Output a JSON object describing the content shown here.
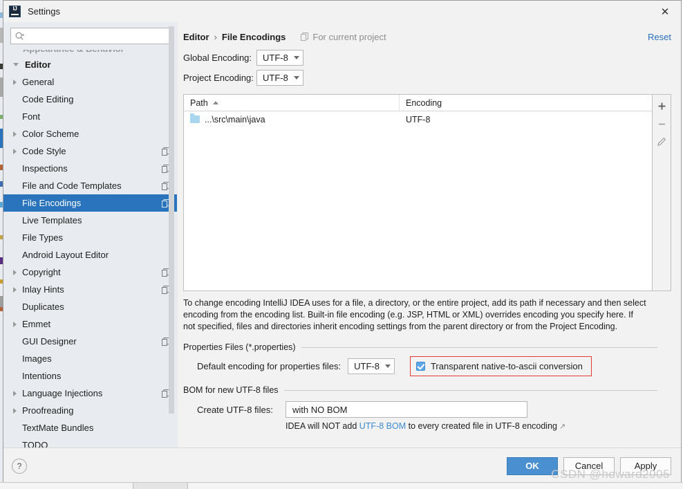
{
  "window": {
    "title": "Settings",
    "logo_icon": "intellij-idea-logo",
    "close_icon": "✕"
  },
  "sidebar": {
    "search": {
      "placeholder": "",
      "value": "",
      "icon": "search-icon"
    },
    "items": [
      {
        "label": "Editor",
        "level": 0,
        "arrow": "down",
        "badge": false,
        "selected": false
      },
      {
        "label": "General",
        "level": 1,
        "arrow": "right",
        "badge": false,
        "selected": false
      },
      {
        "label": "Code Editing",
        "level": 1,
        "arrow": "none",
        "badge": false,
        "selected": false
      },
      {
        "label": "Font",
        "level": 1,
        "arrow": "none",
        "badge": false,
        "selected": false
      },
      {
        "label": "Color Scheme",
        "level": 1,
        "arrow": "right",
        "badge": false,
        "selected": false
      },
      {
        "label": "Code Style",
        "level": 1,
        "arrow": "right",
        "badge": true,
        "selected": false
      },
      {
        "label": "Inspections",
        "level": 1,
        "arrow": "none",
        "badge": true,
        "selected": false
      },
      {
        "label": "File and Code Templates",
        "level": 1,
        "arrow": "none",
        "badge": true,
        "selected": false
      },
      {
        "label": "File Encodings",
        "level": 1,
        "arrow": "none",
        "badge": true,
        "selected": true
      },
      {
        "label": "Live Templates",
        "level": 1,
        "arrow": "none",
        "badge": false,
        "selected": false
      },
      {
        "label": "File Types",
        "level": 1,
        "arrow": "none",
        "badge": false,
        "selected": false
      },
      {
        "label": "Android Layout Editor",
        "level": 1,
        "arrow": "none",
        "badge": false,
        "selected": false
      },
      {
        "label": "Copyright",
        "level": 1,
        "arrow": "right",
        "badge": true,
        "selected": false
      },
      {
        "label": "Inlay Hints",
        "level": 1,
        "arrow": "right",
        "badge": true,
        "selected": false
      },
      {
        "label": "Duplicates",
        "level": 1,
        "arrow": "none",
        "badge": false,
        "selected": false
      },
      {
        "label": "Emmet",
        "level": 1,
        "arrow": "right",
        "badge": false,
        "selected": false
      },
      {
        "label": "GUI Designer",
        "level": 1,
        "arrow": "none",
        "badge": true,
        "selected": false
      },
      {
        "label": "Images",
        "level": 1,
        "arrow": "none",
        "badge": false,
        "selected": false
      },
      {
        "label": "Intentions",
        "level": 1,
        "arrow": "none",
        "badge": false,
        "selected": false
      },
      {
        "label": "Language Injections",
        "level": 1,
        "arrow": "right",
        "badge": true,
        "selected": false
      },
      {
        "label": "Proofreading",
        "level": 1,
        "arrow": "right",
        "badge": false,
        "selected": false
      },
      {
        "label": "TextMate Bundles",
        "level": 1,
        "arrow": "none",
        "badge": false,
        "selected": false
      },
      {
        "label": "TODO",
        "level": 1,
        "arrow": "none",
        "badge": false,
        "selected": false
      }
    ]
  },
  "content": {
    "breadcrumb": {
      "parent": "Editor",
      "separator": "›",
      "current": "File Encodings"
    },
    "for_current_project": "For current project",
    "reset_label": "Reset",
    "global_encoding": {
      "label": "Global Encoding:",
      "value": "UTF-8"
    },
    "project_encoding": {
      "label": "Project Encoding:",
      "value": "UTF-8"
    },
    "table": {
      "columns": [
        "Path",
        "Encoding"
      ],
      "sort_column": "Path",
      "sort_direction": "asc",
      "rows": [
        {
          "path": "...\\src\\main\\java",
          "encoding": "UTF-8"
        }
      ],
      "tools": [
        "add",
        "remove",
        "edit"
      ]
    },
    "description": "To change encoding IntelliJ IDEA uses for a file, a directory, or the entire project, add its path if necessary and then select encoding from the encoding list. Built-in file encoding (e.g. JSP, HTML or XML) overrides encoding you specify here. If not specified, files and directories inherit encoding settings from the parent directory or from the Project Encoding.",
    "properties_group": {
      "title": "Properties Files (*.properties)",
      "default_encoding_label": "Default encoding for properties files:",
      "default_encoding_value": "UTF-8",
      "transparent_checkbox_label": "Transparent native-to-ascii conversion",
      "transparent_checked": true,
      "highlight_color": "#e53935"
    },
    "bom_group": {
      "title": "BOM for new UTF-8 files",
      "create_label": "Create UTF-8 files:",
      "create_value": "with NO BOM",
      "note_prefix": "IDEA will NOT add ",
      "note_link": "UTF-8 BOM",
      "note_suffix": " to every created file in UTF-8 encoding",
      "note_external_icon": "↗"
    }
  },
  "footer": {
    "help_label": "?",
    "ok_label": "OK",
    "cancel_label": "Cancel",
    "apply_label": "Apply",
    "watermark": "CSDN @howard2005",
    "primary_color": "#4a90d0"
  }
}
